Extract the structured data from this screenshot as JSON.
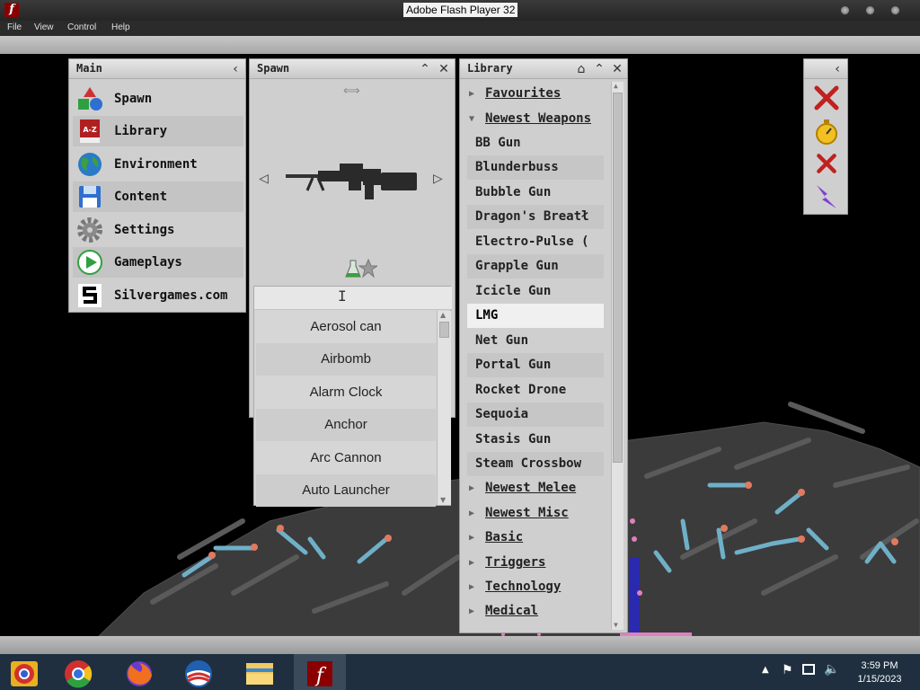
{
  "window": {
    "title": "Adobe Flash Player 32"
  },
  "menu": [
    "File",
    "View",
    "Control",
    "Help"
  ],
  "main_panel": {
    "title": "Main",
    "items": [
      {
        "label": "Spawn",
        "icon": "shapes-icon"
      },
      {
        "label": "Library",
        "icon": "book-a-z-icon"
      },
      {
        "label": "Environment",
        "icon": "globe-icon"
      },
      {
        "label": "Content",
        "icon": "floppy-disk-icon"
      },
      {
        "label": "Settings",
        "icon": "gear-icon"
      },
      {
        "label": "Gameplays",
        "icon": "play-icon"
      },
      {
        "label": "Silvergames.com",
        "icon": "silvergames-logo-icon"
      }
    ]
  },
  "spawn_panel": {
    "title": "Spawn",
    "selected_item_icon": "lmg-gun-icon"
  },
  "spawn_dropdown": {
    "search_value": "",
    "items": [
      "Aerosol can",
      "Airbomb",
      "Alarm Clock",
      "Anchor",
      "Arc Cannon",
      "Auto Launcher"
    ]
  },
  "library_panel": {
    "title": "Library",
    "favourites": "Favourites",
    "newest_weapons": "Newest Weapons",
    "weapons": [
      "BB Gun",
      "Blunderbuss",
      "Bubble Gun",
      "Dragon's Breatł",
      "Electro-Pulse (",
      "Grapple Gun",
      "Icicle Gun",
      "LMG",
      "Net Gun",
      "Portal Gun",
      "Rocket Drone",
      "Sequoia",
      "Stasis Gun",
      "Steam Crossbow"
    ],
    "selected_weapon": "LMG",
    "categories": [
      "Newest Melee",
      "Newest Misc",
      "Basic",
      "Triggers",
      "Technology",
      "Medical"
    ]
  },
  "tools_panel": {
    "icons": [
      "delete-icon",
      "stopwatch-icon",
      "clear-icon",
      "lightning-icon"
    ]
  },
  "taskbar": {
    "apps": [
      "chrome-icon",
      "chrome-icon",
      "firefox-icon",
      "obama-icon",
      "file-explorer-icon",
      "flash-player-icon"
    ],
    "time": "3:59 PM",
    "date": "1/15/2023"
  },
  "colors": {
    "panel": "#cfcfcf",
    "selected_row": "#f0f0f0",
    "taskbar": "#1f2f3f",
    "accent_flash": "#8a0000"
  }
}
